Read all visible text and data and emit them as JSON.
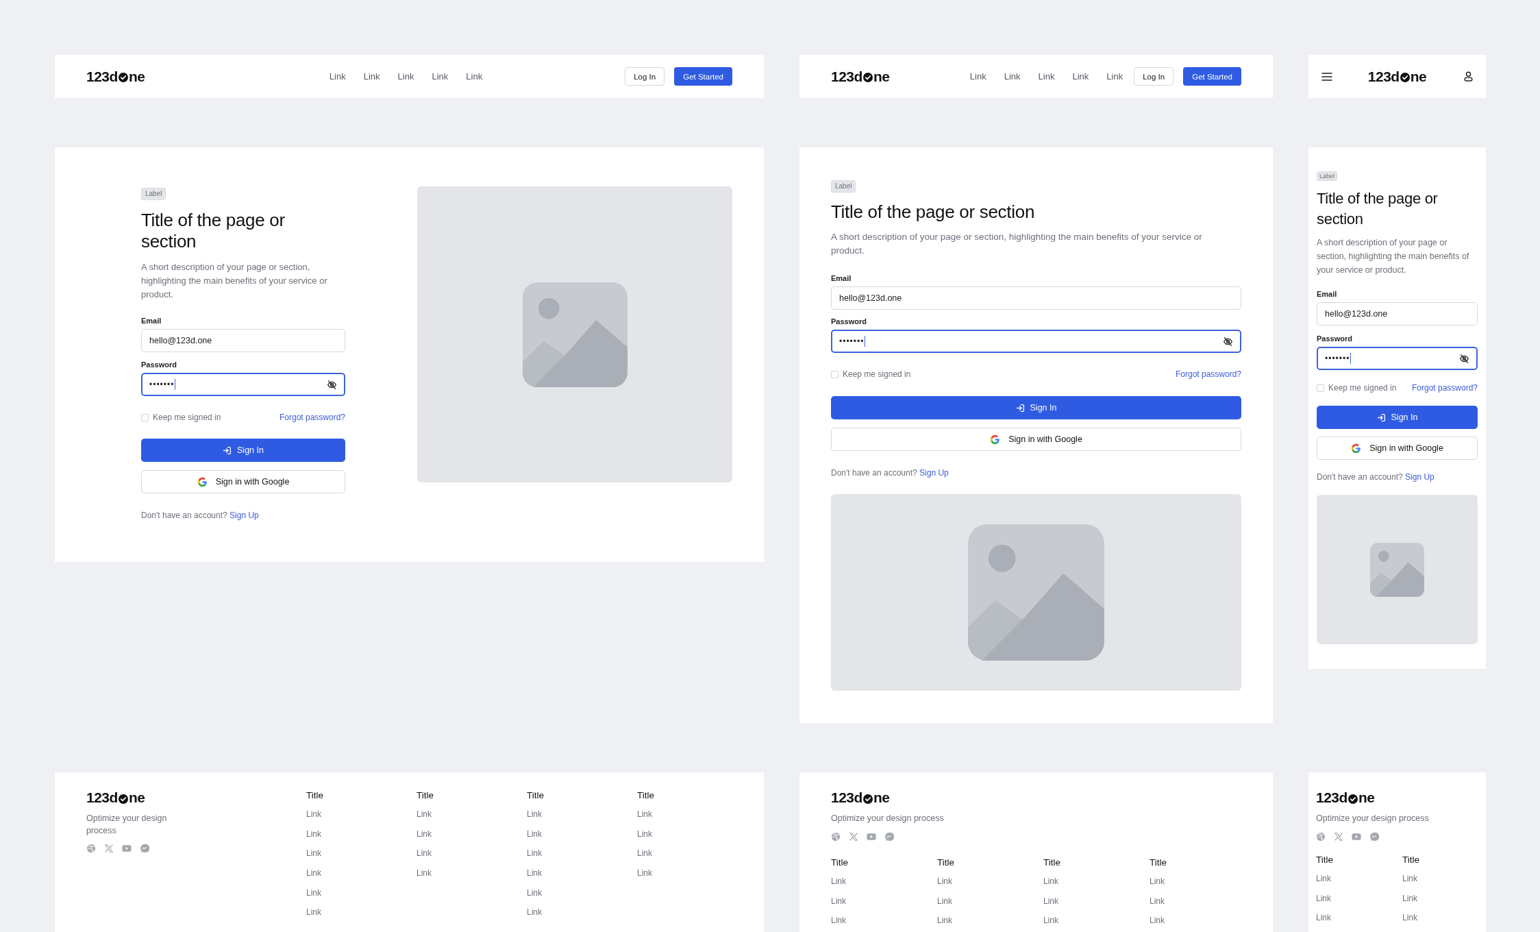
{
  "variants": [
    {
      "kind": "desktop",
      "header": {
        "logo": {
          "before": "123d",
          "after": "ne"
        },
        "nav_links": [
          "Link",
          "Link",
          "Link",
          "Link",
          "Link"
        ],
        "log_in": "Log In",
        "get_started": "Get Started"
      },
      "hero": {
        "label": "Label",
        "title": "Title of the page or section",
        "description": "A short description of your page or section, highlighting the main benefits of your service or product.",
        "email": {
          "label": "Email",
          "value": "hello@123d.one"
        },
        "password": {
          "label": "Password",
          "value": "•••••••",
          "focused": true
        },
        "remember": {
          "label": "Keep me signed in",
          "checked": false
        },
        "forgot": "Forgot password?",
        "sign_in": "Sign In",
        "google": "Sign in with Google",
        "prompt": "Don't have an account?",
        "sign_up": "Sign Up"
      },
      "footer": {
        "logo": {
          "before": "123d",
          "after": "ne"
        },
        "tagline": "Optimize your design process",
        "columns": [
          {
            "title": "Title",
            "links": [
              "Link",
              "Link",
              "Link",
              "Link",
              "Link",
              "Link"
            ]
          },
          {
            "title": "Title",
            "links": [
              "Link",
              "Link",
              "Link",
              "Link"
            ]
          },
          {
            "title": "Title",
            "links": [
              "Link",
              "Link",
              "Link",
              "Link",
              "Link",
              "Link"
            ]
          },
          {
            "title": "Title",
            "links": [
              "Link",
              "Link",
              "Link",
              "Link"
            ]
          }
        ]
      }
    },
    {
      "kind": "tablet",
      "header": {
        "logo": {
          "before": "123d",
          "after": "ne"
        },
        "nav_links": [
          "Link",
          "Link",
          "Link",
          "Link",
          "Link"
        ],
        "log_in": "Log In",
        "get_started": "Get Started"
      },
      "hero": {
        "label": "Label",
        "title": "Title of the page or section",
        "description": "A short description of your page or section, highlighting the main benefits of your service or product.",
        "email": {
          "label": "Email",
          "value": "hello@123d.one"
        },
        "password": {
          "label": "Password",
          "value": "•••••••",
          "focused": true
        },
        "remember": {
          "label": "Keep me signed in",
          "checked": false
        },
        "forgot": "Forgot password?",
        "sign_in": "Sign In",
        "google": "Sign in with Google",
        "prompt": "Don't have an account?",
        "sign_up": "Sign Up"
      },
      "footer": {
        "logo": {
          "before": "123d",
          "after": "ne"
        },
        "tagline": "Optimize your design process",
        "columns": [
          {
            "title": "Title",
            "links": [
              "Link",
              "Link",
              "Link"
            ]
          },
          {
            "title": "Title",
            "links": [
              "Link",
              "Link",
              "Link"
            ]
          },
          {
            "title": "Title",
            "links": [
              "Link",
              "Link",
              "Link"
            ]
          },
          {
            "title": "Title",
            "links": [
              "Link",
              "Link",
              "Link"
            ]
          }
        ]
      }
    },
    {
      "kind": "mobile",
      "header": {
        "logo": {
          "before": "123d",
          "after": "ne"
        }
      },
      "hero": {
        "label": "Label",
        "title": "Title of the page or section",
        "description": "A short description of your page or section, highlighting the main benefits of your service or product.",
        "email": {
          "label": "Email",
          "value": "hello@123d.one"
        },
        "password": {
          "label": "Password",
          "value": "•••••••",
          "focused": true
        },
        "remember": {
          "label": "Keep me signed in",
          "checked": false
        },
        "forgot": "Forgot password?",
        "sign_in": "Sign In",
        "google": "Sign in with Google",
        "prompt": "Don't have an account?",
        "sign_up": "Sign Up"
      },
      "footer": {
        "logo": {
          "before": "123d",
          "after": "ne"
        },
        "tagline": "Optimize your design process",
        "columns": [
          {
            "title": "Title",
            "links": [
              "Link",
              "Link",
              "Link"
            ]
          },
          {
            "title": "Title",
            "links": [
              "Link",
              "Link",
              "Link"
            ]
          }
        ]
      }
    }
  ]
}
